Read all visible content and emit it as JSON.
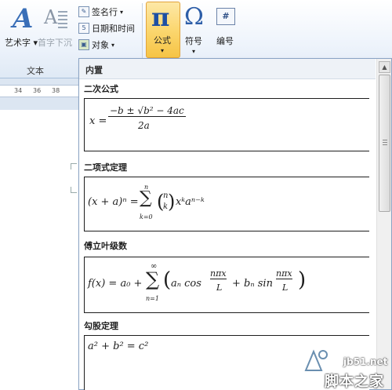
{
  "ribbon": {
    "wordart": {
      "label": "艺术字",
      "arrow": "▾",
      "icon": "wordart-icon"
    },
    "dropcap": {
      "label": "首字下沉",
      "arrow": "▾",
      "icon": "dropcap-icon"
    },
    "signature": {
      "label": "签名行",
      "arrow": "▾",
      "icon": "signature-line-icon"
    },
    "datetime": {
      "label": "日期和时间",
      "icon": "calendar-icon"
    },
    "object": {
      "label": "对象",
      "arrow": "▾",
      "icon": "object-icon"
    },
    "equation": {
      "label": "公式",
      "glyph": "π",
      "arrow": "▾"
    },
    "symbol": {
      "label": "符号",
      "glyph": "Ω",
      "arrow": "▾"
    },
    "number": {
      "label": "编号",
      "glyph": "#"
    },
    "group_text_label": "文本"
  },
  "ruler": {
    "ticks": [
      "34",
      "36",
      "38"
    ]
  },
  "gallery": {
    "header": "内置",
    "sections": [
      {
        "title": "二次公式"
      },
      {
        "title": "二项式定理"
      },
      {
        "title": "傅立叶级数"
      },
      {
        "title": "勾股定理"
      }
    ],
    "formulas": {
      "quadratic": {
        "lhs": "x =",
        "num": "−b ± √b² − 4ac",
        "den": "2a"
      },
      "binomial": {
        "lhs": "(x + a)ⁿ =",
        "sum_top": "n",
        "sum_sym": "∑",
        "sum_bot": "k=0",
        "binom_n": "n",
        "binom_k": "k",
        "tail": "xᵏaⁿ⁻ᵏ"
      },
      "fourier": {
        "lhs": "f(x) = a₀ +",
        "sum_top": "∞",
        "sum_sym": "∑",
        "sum_bot": "n=1",
        "term1": "aₙ cos",
        "frac1_num": "nπx",
        "frac1_den": "L",
        "plus": "+ bₙ sin",
        "frac2_num": "nπx",
        "frac2_den": "L"
      },
      "pythagorean": {
        "text": "a² + b² = c²"
      }
    }
  },
  "watermark": {
    "url": "jb51.net",
    "text": "脚本之家"
  },
  "colors": {
    "accent_blue": "#1d4fa3",
    "selected_bg": "#fbd770",
    "selected_border": "#e2a33b"
  }
}
